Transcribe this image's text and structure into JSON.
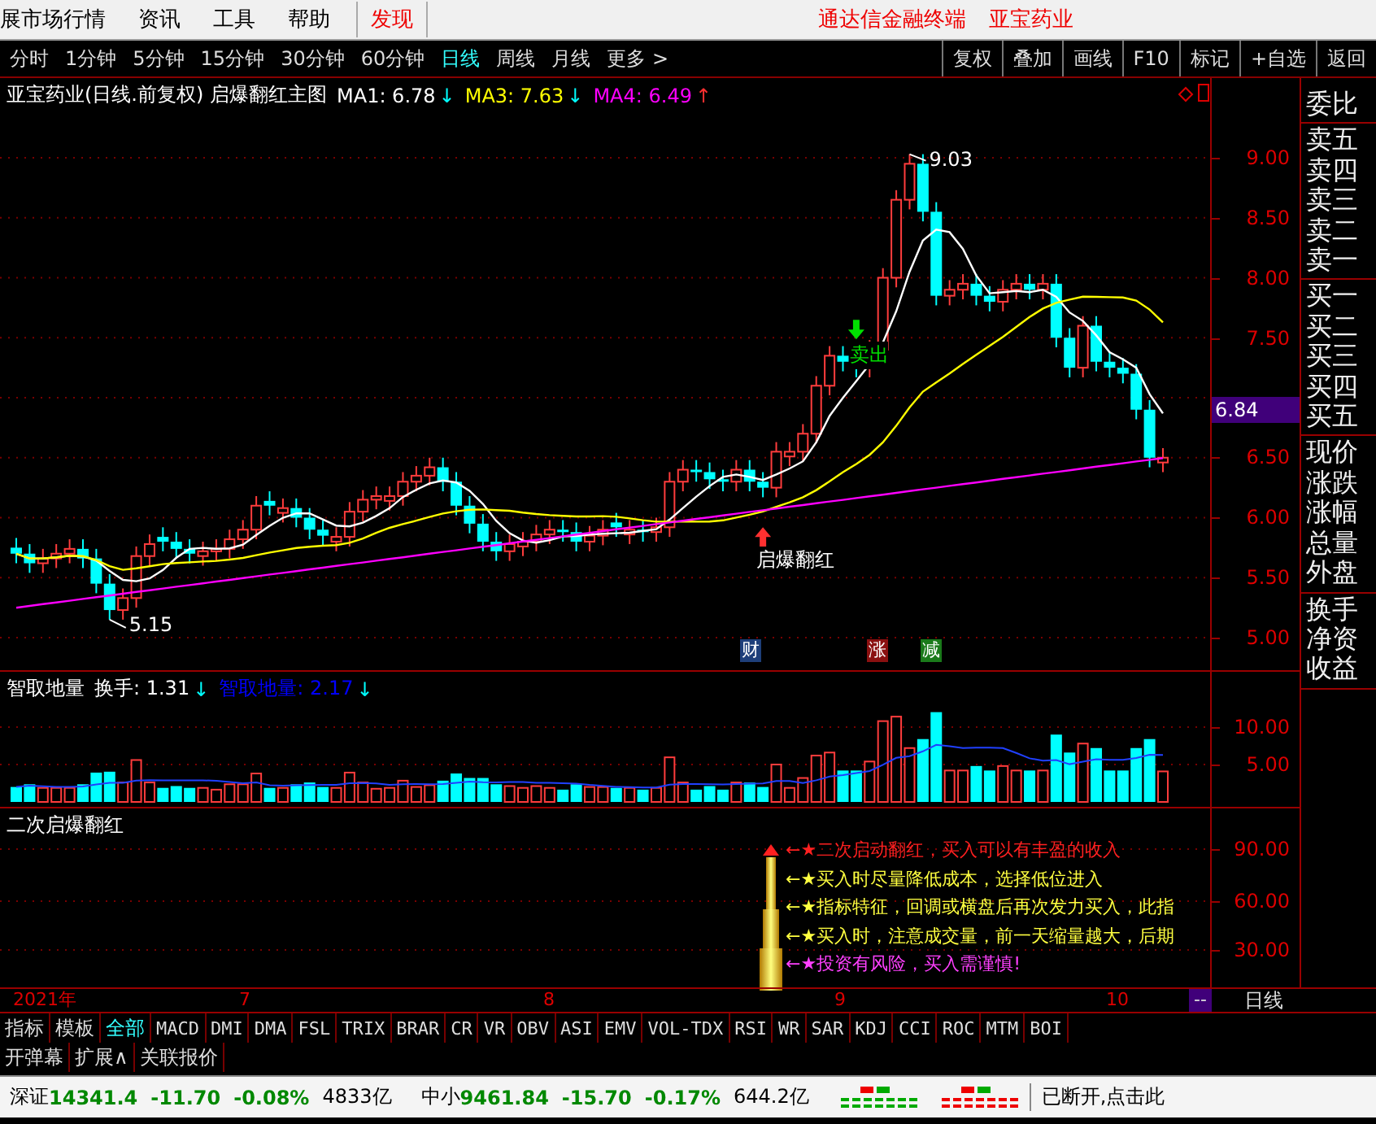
{
  "menu_bar": {
    "items": [
      "展市场行情",
      "资讯",
      "工具",
      "帮助"
    ],
    "discover": "发现",
    "app_title": "通达信金融终端",
    "stock_name": "亚宝药业"
  },
  "period_bar": {
    "periods": [
      {
        "label": "分时",
        "selected": false
      },
      {
        "label": "1分钟",
        "selected": false
      },
      {
        "label": "5分钟",
        "selected": false
      },
      {
        "label": "15分钟",
        "selected": false
      },
      {
        "label": "30分钟",
        "selected": false
      },
      {
        "label": "60分钟",
        "selected": false
      },
      {
        "label": "日线",
        "selected": true
      },
      {
        "label": "周线",
        "selected": false
      },
      {
        "label": "月线",
        "selected": false
      },
      {
        "label": "更多 >",
        "selected": false
      }
    ],
    "buttons": [
      "复权",
      "叠加",
      "画线",
      "F10",
      "标记",
      "+自选",
      "返回"
    ]
  },
  "main_chart": {
    "title": "亚宝药业(日线.前复权) 启爆翻红主图",
    "indicators": [
      {
        "label": "MA1: 6.78",
        "arrow": {
          "text": "↓",
          "color": "#00ffff"
        },
        "color": "#ffffff"
      },
      {
        "label": "MA3: 7.63",
        "arrow": {
          "text": "↓",
          "color": "#00ffff"
        },
        "color": "#ffff00"
      },
      {
        "label": "MA4: 6.49",
        "arrow": {
          "text": "↑",
          "color": "#ff3030"
        },
        "color": "#ff00ff"
      }
    ],
    "price_ticks": [
      "9.00",
      "8.50",
      "8.00",
      "7.50",
      "6.50",
      "6.00",
      "5.50",
      "5.00"
    ],
    "current_price": "6.84",
    "high_label": "9.03",
    "low_label": "5.15",
    "signals": [
      {
        "label": "启爆翻红",
        "kind": "buy"
      },
      {
        "label": "卖出",
        "kind": "sell"
      }
    ],
    "event_badges": [
      {
        "label": "财",
        "color": "#1e3f7a"
      },
      {
        "label": "涨",
        "color": "#8a1010"
      },
      {
        "label": "减",
        "color": "#1a7a1a"
      }
    ]
  },
  "volume_panel": {
    "title": "智取地量",
    "indicators": [
      {
        "label": "换手: 1.31",
        "arrow": {
          "text": "↓",
          "color": "#00ffff"
        },
        "color": "#ffffff"
      },
      {
        "label": "智取地量: 2.17",
        "arrow": {
          "text": "↓",
          "color": "#00ffff"
        },
        "color": "#0000ff"
      }
    ],
    "ticks": [
      "10.00",
      "5.00"
    ]
  },
  "indicator_panel": {
    "title": "二次启爆翻红",
    "ticks": [
      "90.00",
      "60.00",
      "30.00"
    ],
    "notes": [
      {
        "text": "←★二次启动翻红，买入可以有丰盈的收入",
        "color": "#ff2020"
      },
      {
        "text": "←★买入时尽量降低成本，选择低位进入",
        "color": "#ffff40"
      },
      {
        "text": "←★指标特征，回调或横盘后再次发力买入，此指",
        "color": "#ffff40"
      },
      {
        "text": "←★买入时，注意成交量，前一天缩量越大，后期",
        "color": "#ffff40"
      },
      {
        "text": "←★投资有风险，买入需谨慎!",
        "color": "#ff40ff"
      }
    ]
  },
  "date_axis": {
    "labels": [
      "2021年",
      "7",
      "8",
      "9",
      "10"
    ],
    "end_marker": "--",
    "period": "日线"
  },
  "indicator_tabs": [
    {
      "label": "指标",
      "selected": false
    },
    {
      "label": "模板",
      "selected": false
    },
    {
      "label": "全部",
      "selected": true
    },
    {
      "label": "MACD",
      "selected": false
    },
    {
      "label": "DMI",
      "selected": false
    },
    {
      "label": "DMA",
      "selected": false
    },
    {
      "label": "FSL",
      "selected": false
    },
    {
      "label": "TRIX",
      "selected": false
    },
    {
      "label": "BRAR",
      "selected": false
    },
    {
      "label": "CR",
      "selected": false
    },
    {
      "label": "VR",
      "selected": false
    },
    {
      "label": "OBV",
      "selected": false
    },
    {
      "label": "ASI",
      "selected": false
    },
    {
      "label": "EMV",
      "selected": false
    },
    {
      "label": "VOL-TDX",
      "selected": false
    },
    {
      "label": "RSI",
      "selected": false
    },
    {
      "label": "WR",
      "selected": false
    },
    {
      "label": "SAR",
      "selected": false
    },
    {
      "label": "KDJ",
      "selected": false
    },
    {
      "label": "CCI",
      "selected": false
    },
    {
      "label": "ROC",
      "selected": false
    },
    {
      "label": "MTM",
      "selected": false
    },
    {
      "label": "BOI",
      "selected": false
    }
  ],
  "bottom_tabs": [
    "开弹幕",
    "扩展∧",
    "关联报价"
  ],
  "quote_groups": [
    {
      "labels": [
        "委比"
      ]
    },
    {
      "labels": [
        "卖五",
        "卖四",
        "卖三",
        "卖二",
        "卖一"
      ]
    },
    {
      "labels": [
        "买一",
        "买二",
        "买三",
        "买四",
        "买五"
      ]
    },
    {
      "labels": [
        "现价",
        "涨跌",
        "涨幅",
        "总量",
        "外盘"
      ]
    },
    {
      "labels": [
        "换手",
        "净资",
        "收益"
      ]
    }
  ],
  "status_bar": {
    "indices": [
      {
        "name": "深证",
        "value": "14341.4",
        "change": "-11.70",
        "percent": "-0.08%",
        "amount": "4833亿"
      },
      {
        "name": "中小",
        "value": "9461.84",
        "change": "-15.70",
        "percent": "-0.17%",
        "amount": "644.2亿"
      }
    ],
    "connection": "已断开,点击此"
  }
}
